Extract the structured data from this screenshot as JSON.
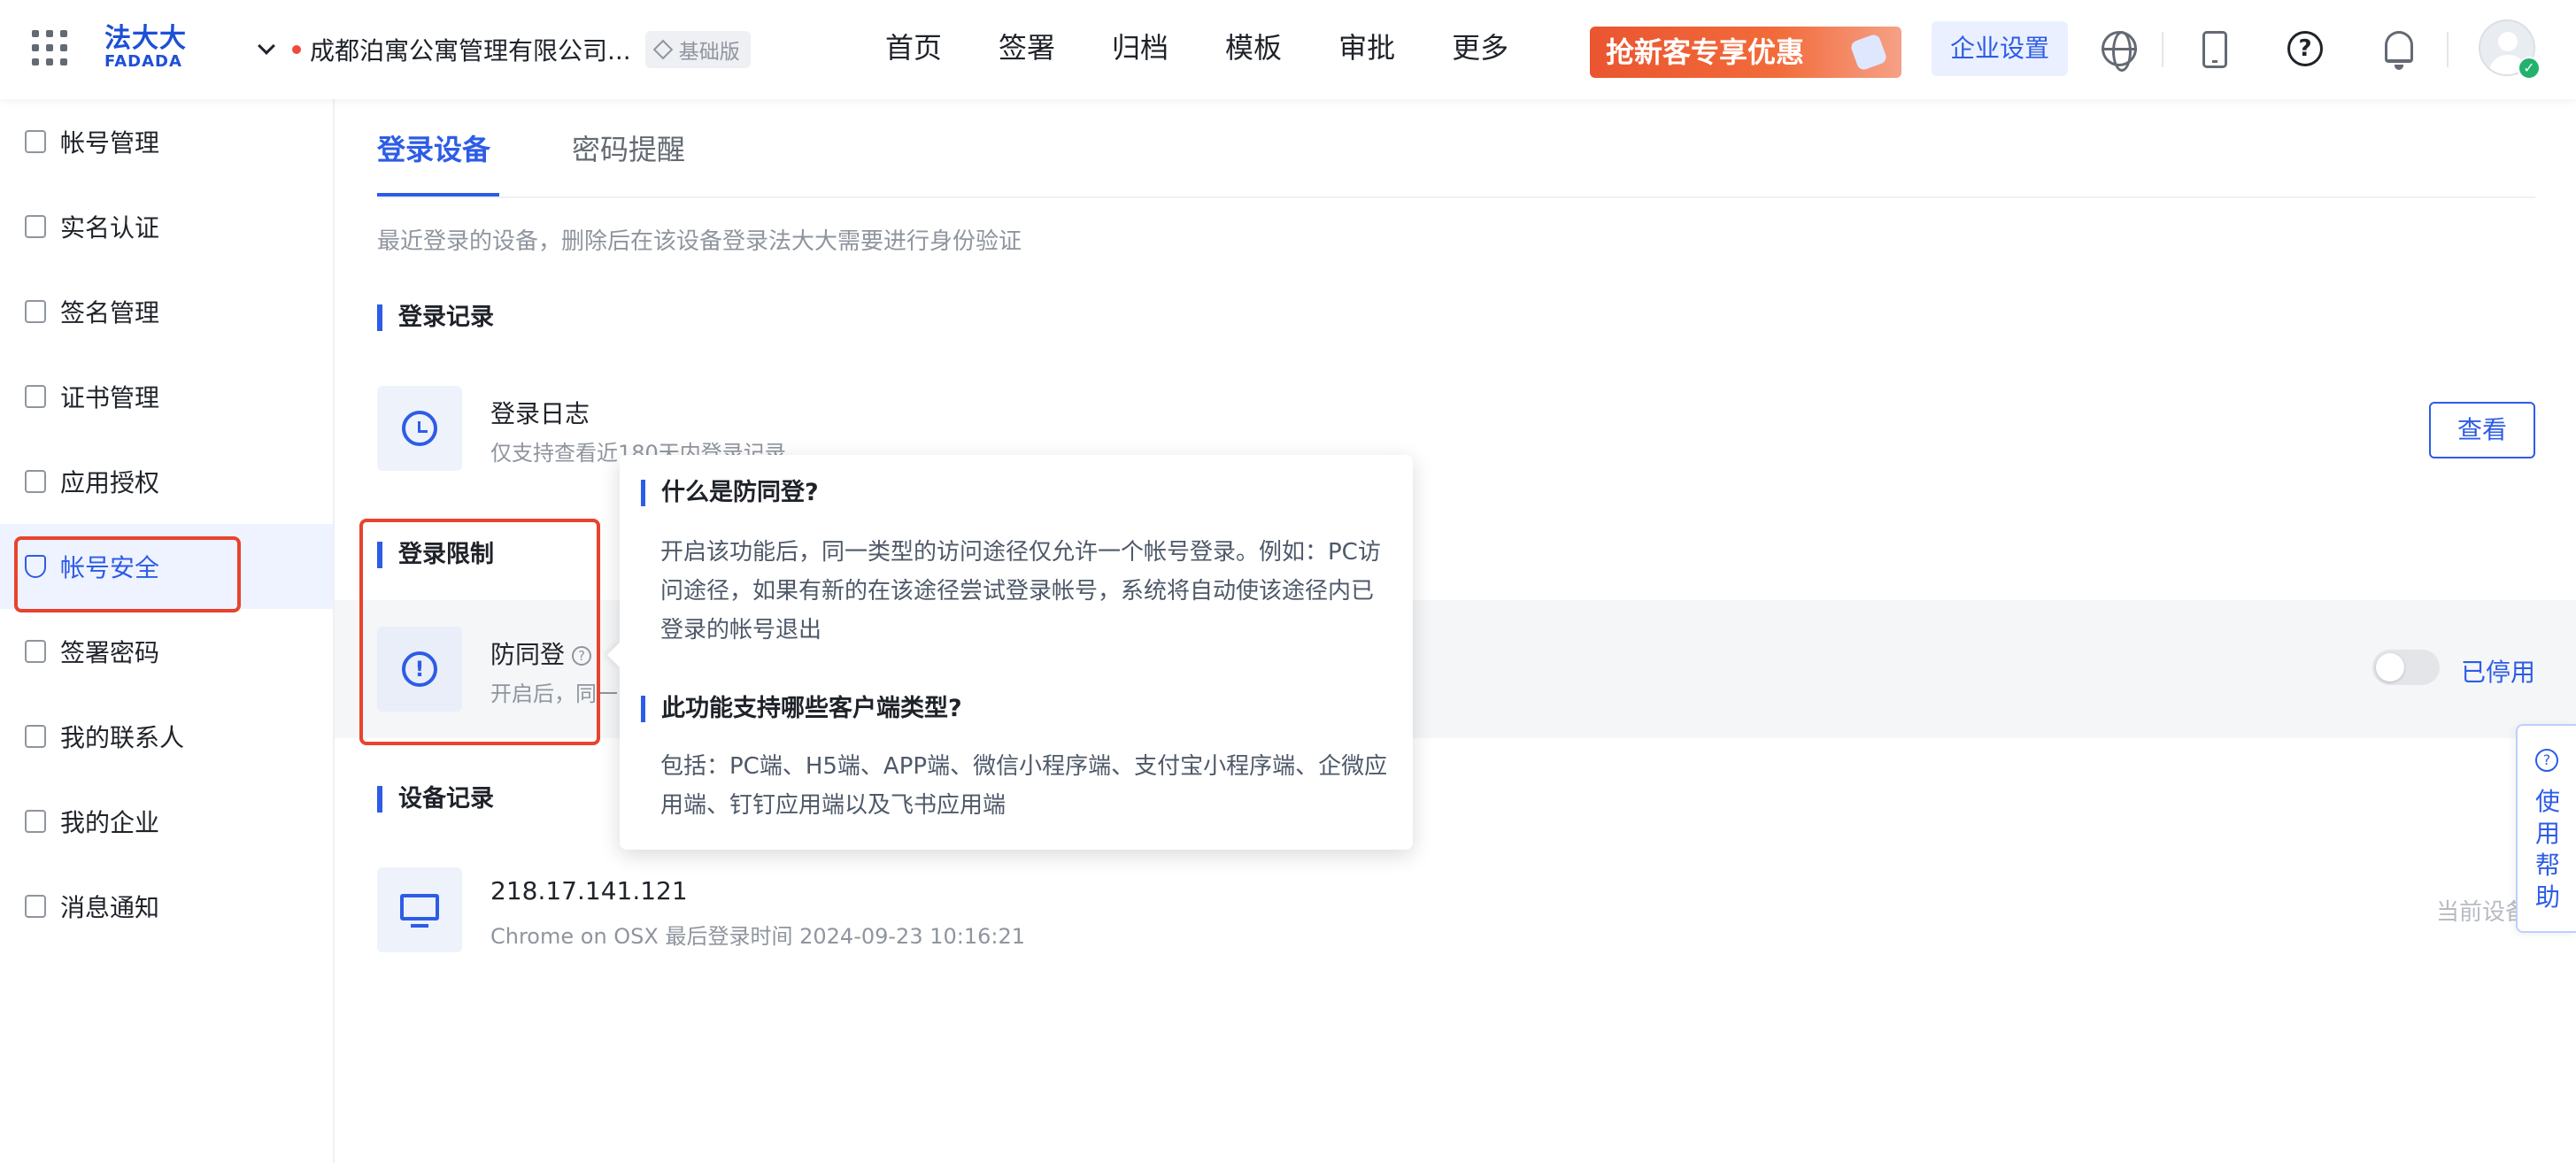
{
  "header": {
    "logo_top": "法大大",
    "logo_bottom": "FADADA",
    "org_name": "成都泊寓公寓管理有限公司...",
    "edition_badge": "基础版",
    "nav": [
      "首页",
      "签署",
      "归档",
      "模板",
      "审批",
      "更多"
    ],
    "promo_label": "抢新客专享优惠",
    "enterprise_settings": "企业设置",
    "help_glyph": "?"
  },
  "sidebar": {
    "items": [
      {
        "label": "帐号管理"
      },
      {
        "label": "实名认证"
      },
      {
        "label": "签名管理"
      },
      {
        "label": "证书管理"
      },
      {
        "label": "应用授权"
      },
      {
        "label": "帐号安全",
        "active": true
      },
      {
        "label": "签署密码"
      },
      {
        "label": "我的联系人"
      },
      {
        "label": "我的企业"
      },
      {
        "label": "消息通知"
      }
    ]
  },
  "main": {
    "tabs": [
      {
        "label": "登录设备",
        "active": true
      },
      {
        "label": "密码提醒"
      }
    ],
    "description": "最近登录的设备，删除后在该设备登录法大大需要进行身份验证",
    "login_records": {
      "section_title": "登录记录",
      "log_title": "登录日志",
      "log_subtitle": "仅支持查看近180天内登录记录",
      "view_button": "查看"
    },
    "login_restrictions": {
      "section_title": "登录限制",
      "feature_title": "防同登",
      "feature_subtitle": "开启后，同一",
      "toggle_on": false,
      "status_text": "已停用"
    },
    "device_records": {
      "section_title": "设备记录",
      "ip": "218.17.141.121",
      "detail": "Chrome on OSX 最后登录时间 2024-09-23 10:16:21",
      "current_label": "当前设备"
    }
  },
  "tooltip": {
    "q1": "什么是防同登?",
    "a1": "开启该功能后，同一类型的访问途径仅允许一个帐号登录。例如：PC访问途径，如果有新的在该途径尝试登录帐号，系统将自动使该途径内已登录的帐号退出",
    "q2": "此功能支持哪些客户端类型?",
    "a2": "包括：PC端、H5端、APP端、微信小程序端、支付宝小程序端、企微应用端、钉钉应用端以及飞书应用端"
  },
  "help_float": {
    "label": "使用帮助"
  },
  "colors": {
    "accent": "#2d5ce6",
    "highlight_box": "#e8432e",
    "promo": "#ea5530"
  }
}
